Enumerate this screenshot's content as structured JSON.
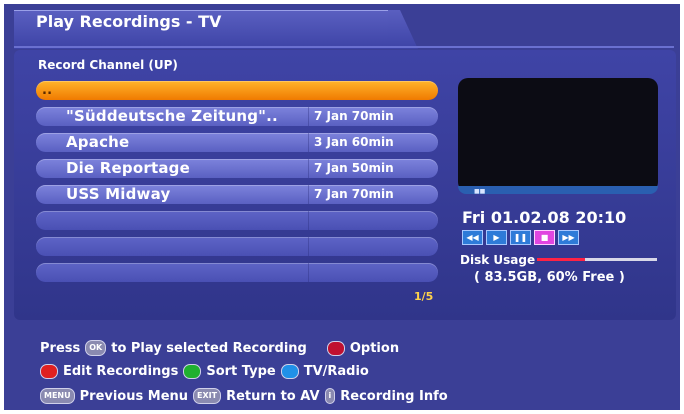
{
  "header": {
    "title": "Play Recordings - TV"
  },
  "list": {
    "heading": "Record Channel (UP)",
    "selected_label": "..",
    "items": [
      {
        "name": "\"Süddeutsche Zeitung\"..",
        "date": "7 Jan 70min"
      },
      {
        "name": "Apache",
        "date": "3 Jan 60min"
      },
      {
        "name": "Die Reportage",
        "date": "7 Jan 50min"
      },
      {
        "name": "USS Midway",
        "date": "7 Jan 70min"
      }
    ],
    "page": "1/5"
  },
  "status": {
    "datetime": "Fri 01.02.08   20:10",
    "disk_label": "Disk Usage",
    "disk_info": "( 83.5GB, 60% Free )",
    "disk_used_fraction": 0.4
  },
  "controls": {
    "icons": [
      "rewind-icon",
      "play-icon",
      "pause-icon",
      "stop-icon",
      "fast-forward-icon"
    ],
    "glyphs": [
      "◀◀",
      "▶",
      "❚❚",
      "■",
      "▶▶"
    ]
  },
  "help": {
    "press": "Press",
    "ok_key": "OK",
    "play_text": "to Play selected Recording",
    "option": "Option",
    "edit": "Edit Recordings",
    "sort": "Sort Type",
    "tvradio": "TV/Radio",
    "menu_key": "MENU",
    "previous_menu": "Previous Menu",
    "exit_key": "EXIT",
    "return_av": "Return to AV",
    "info_key": "i",
    "recording_info": "Recording Info"
  },
  "colors": {
    "red": "#e02020",
    "green": "#20b030",
    "blue": "#2090e8",
    "option_red": "#c01030",
    "selected": "#f59a10"
  }
}
